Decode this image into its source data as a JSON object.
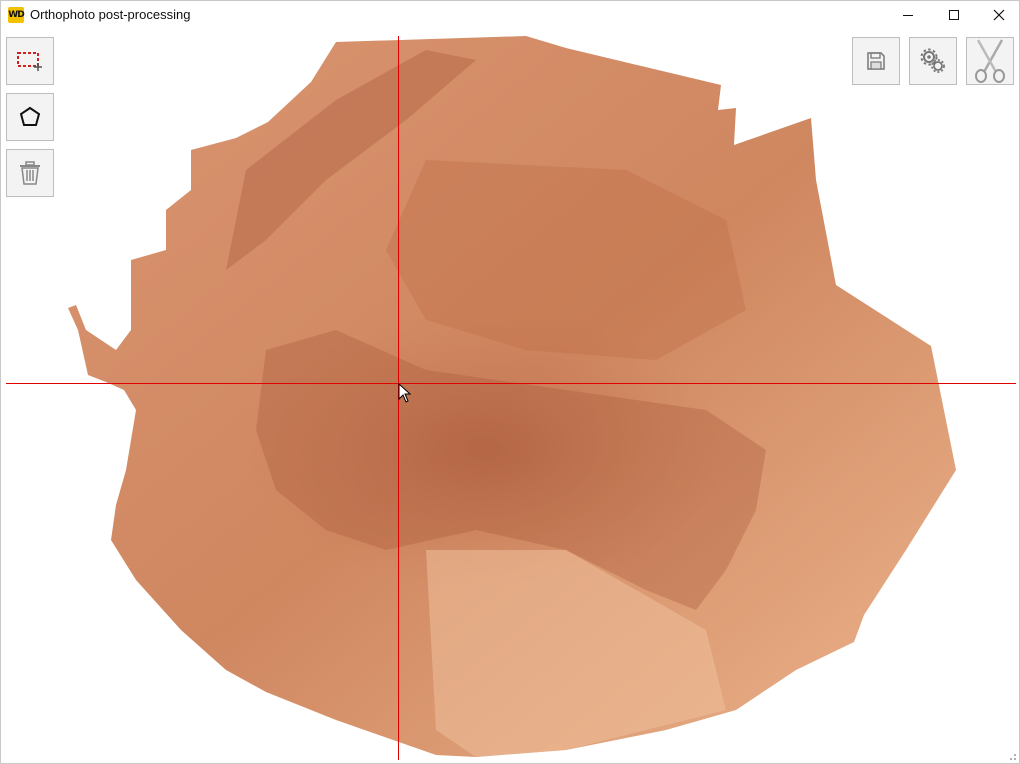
{
  "window": {
    "title": "Orthophoto post-processing",
    "logo_text": "WD"
  },
  "toolbar_left": [
    {
      "name": "rectangle-select",
      "icon": "rectangle-select-icon"
    },
    {
      "name": "polygon-select",
      "icon": "polygon-icon"
    },
    {
      "name": "delete",
      "icon": "trash-icon"
    }
  ],
  "toolbar_right": [
    {
      "name": "save",
      "icon": "floppy-disk-icon"
    },
    {
      "name": "settings",
      "icon": "gears-icon"
    },
    {
      "name": "cut",
      "icon": "scissors-icon"
    }
  ],
  "colors": {
    "crosshair": "#e00000",
    "terrain_light": "#e8a880",
    "terrain_mid": "#cf8760",
    "terrain_dark": "#a85a3a"
  }
}
